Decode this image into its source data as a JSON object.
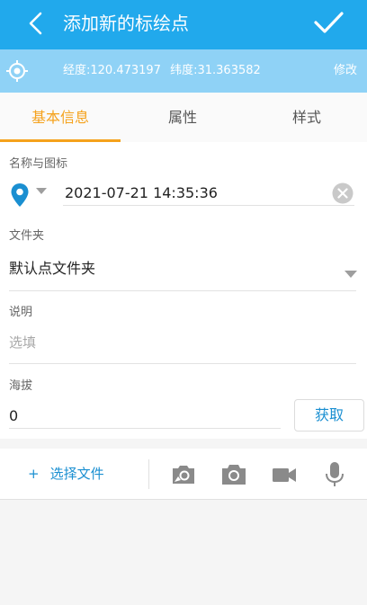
{
  "header": {
    "title": "添加新的标绘点"
  },
  "location": {
    "longitude": "经度:120.473197",
    "latitude": "纬度:31.363582",
    "edit_label": "修改"
  },
  "tabs": [
    {
      "label": "基本信息",
      "active": true
    },
    {
      "label": "属性",
      "active": false
    },
    {
      "label": "样式",
      "active": false
    }
  ],
  "form": {
    "name_label": "名称与图标",
    "name_value": "2021-07-21 14:35:36",
    "folder_label": "文件夹",
    "folder_value": "默认点文件夹",
    "description_label": "说明",
    "description_placeholder": "选填",
    "altitude_label": "海拔",
    "altitude_value": "0",
    "fetch_label": "获取"
  },
  "toolbar": {
    "plus": "+",
    "choose_file_label": "选择文件"
  },
  "colors": {
    "appbar": "#21a9ec",
    "locbar": "#8fd2f6",
    "accent": "#f5a21c",
    "link": "#1a8fd1",
    "pin": "#1a8fd1"
  },
  "icons": [
    "back-icon",
    "check-icon",
    "locate-icon",
    "map-pin-icon",
    "caret-down-icon",
    "clear-icon",
    "photo-gallery-icon",
    "camera-icon",
    "video-icon",
    "microphone-icon"
  ]
}
